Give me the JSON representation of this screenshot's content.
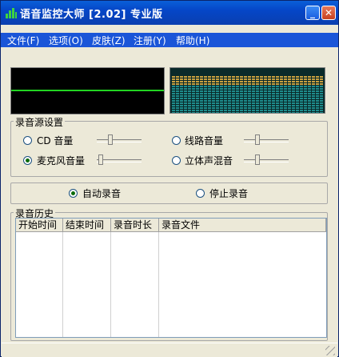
{
  "window": {
    "title": "语音监控大师 [2.02] 专业版"
  },
  "titlebar": {
    "minimize_icon": "minimize-icon",
    "close_icon": "close-icon"
  },
  "menu": {
    "items": [
      {
        "label": "文件(F)"
      },
      {
        "label": "选项(O)"
      },
      {
        "label": "皮肤(Z)"
      },
      {
        "label": "注册(Y)"
      },
      {
        "label": "帮助(H)"
      }
    ]
  },
  "source_group": {
    "title": "录音源设置",
    "options": [
      {
        "label": "CD 音量",
        "selected": false,
        "level": 0.3
      },
      {
        "label": "线路音量",
        "selected": false,
        "level": 0.3
      },
      {
        "label": "麦克风音量",
        "selected": true,
        "level": 0.05
      },
      {
        "label": "立体声混音",
        "selected": false,
        "level": 0.3
      }
    ]
  },
  "mode_group": {
    "auto_label": "自动录音",
    "auto_selected": true,
    "stop_label": "停止录音",
    "stop_selected": false
  },
  "history": {
    "title": "录音历史",
    "columns": [
      "开始时间",
      "结束时间",
      "录音时长",
      "录音文件"
    ],
    "rows": []
  },
  "colors": {
    "scope_line": "#22d422",
    "spectrum_bar": "#1e8c8c",
    "spectrum_peak": "#c8a040",
    "menubar": "#1a55d8"
  }
}
